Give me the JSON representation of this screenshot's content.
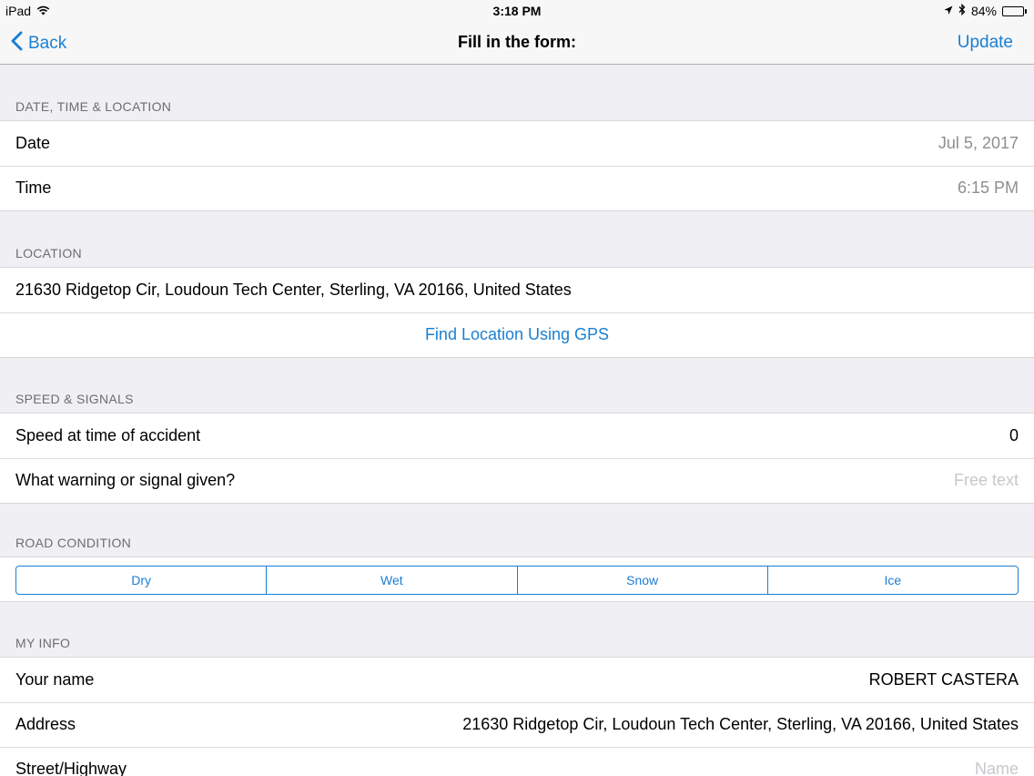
{
  "status_bar": {
    "device": "iPad",
    "time": "3:18 PM",
    "battery_percent": "84%",
    "battery_level": 0.84,
    "icons": [
      "wifi-icon",
      "location-arrow-icon",
      "bluetooth-icon",
      "battery-icon"
    ]
  },
  "nav": {
    "back_label": "Back",
    "title": "Fill in the form:",
    "update_label": "Update",
    "accent_color": "#1a7fd3"
  },
  "sections": {
    "datetime": {
      "header": "DATE, TIME & LOCATION",
      "date_label": "Date",
      "date_value": "Jul 5, 2017",
      "time_label": "Time",
      "time_value": "6:15 PM"
    },
    "location": {
      "header": "LOCATION",
      "address": "21630 Ridgetop Cir, Loudoun Tech Center, Sterling, VA 20166, United States",
      "gps_button": "Find Location Using GPS"
    },
    "speed": {
      "header": "SPEED & SIGNALS",
      "speed_label": "Speed at time of accident",
      "speed_value": "0",
      "signal_label": "What warning or signal given?",
      "signal_placeholder": "Free text"
    },
    "road": {
      "header": "ROAD CONDITION",
      "options": [
        "Dry",
        "Wet",
        "Snow",
        "Ice"
      ]
    },
    "my_info": {
      "header": "MY INFO",
      "name_label": "Your name",
      "name_value": "ROBERT CASTERA",
      "address_label": "Address",
      "address_value": "21630 Ridgetop Cir, Loudoun Tech Center, Sterling, VA 20166, United States",
      "street_label": "Street/Highway",
      "street_placeholder": "Name"
    }
  }
}
